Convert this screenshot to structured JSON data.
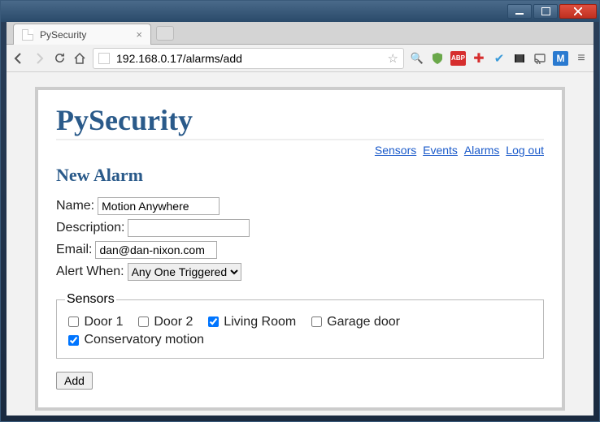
{
  "window": {
    "tab_title": "PySecurity",
    "url": "192.168.0.17/alarms/add"
  },
  "toolbar_ext": {
    "abp": "ABP",
    "m": "M"
  },
  "page": {
    "app_title": "PySecurity",
    "nav": {
      "sensors": "Sensors",
      "events": "Events",
      "alarms": "Alarms",
      "logout": "Log out"
    },
    "section_title": "New Alarm",
    "labels": {
      "name": "Name:",
      "description": "Description:",
      "email": "Email:",
      "alert_when": "Alert When:",
      "sensors_legend": "Sensors"
    },
    "values": {
      "name": "Motion Anywhere",
      "description": "",
      "email": "dan@dan-nixon.com",
      "alert_when_selected": "Any One Triggered"
    },
    "sensors": [
      {
        "label": "Door 1",
        "checked": false
      },
      {
        "label": "Door 2",
        "checked": false
      },
      {
        "label": "Living Room",
        "checked": true
      },
      {
        "label": "Garage door",
        "checked": false
      },
      {
        "label": "Conservatory motion",
        "checked": true
      }
    ],
    "add_button": "Add"
  }
}
